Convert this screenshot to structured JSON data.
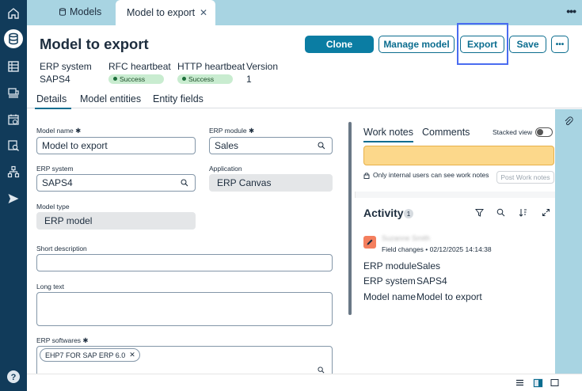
{
  "colors": {
    "primary": "#0b7da3",
    "rail": "#113b5a",
    "tabbar": "#a8d4e2",
    "success": "#c9ecd0",
    "note_bg": "#fcd88b",
    "highlight": "#4a6cf0"
  },
  "rail": {
    "icons": [
      "home-icon",
      "database-icon",
      "table-icon",
      "transport-icon",
      "schedule-icon",
      "search-doc-icon",
      "hierarchy-icon",
      "send-icon",
      "help-icon"
    ]
  },
  "tabs": {
    "models_label": "Models",
    "active_label": "Model to export"
  },
  "header": {
    "title": "Model to export",
    "buttons": {
      "clone": "Clone",
      "manage": "Manage model",
      "export": "Export",
      "save": "Save"
    }
  },
  "meta": {
    "erp_system_label": "ERP system",
    "erp_system_value": "SAPS4",
    "rfc_label": "RFC heartbeat",
    "rfc_status": "Success",
    "http_label": "HTTP heartbeat",
    "http_status": "Success",
    "version_label": "Version",
    "version_value": "1"
  },
  "subtabs": [
    "Details",
    "Model entities",
    "Entity fields"
  ],
  "form": {
    "model_name_label": "Model name",
    "model_name_value": "Model to export",
    "erp_module_label": "ERP module",
    "erp_module_value": "Sales",
    "erp_system_label": "ERP system",
    "erp_system_value": "SAPS4",
    "application_label": "Application",
    "application_value": "ERP Canvas",
    "model_type_label": "Model type",
    "model_type_value": "ERP model",
    "short_desc_label": "Short description",
    "long_text_label": "Long text",
    "erp_softwares_label": "ERP softwares",
    "erp_softwares_chip": "EHP7 FOR SAP ERP 6.0"
  },
  "notes": {
    "tab_work_notes": "Work notes",
    "tab_comments": "Comments",
    "stacked_view": "Stacked view",
    "internal_hint": "Only internal users can see work notes",
    "post_button": "Post Work notes"
  },
  "activity": {
    "title": "Activity",
    "count": "1",
    "user_name": "Suzanne Smith",
    "change_line": "Field changes • 02/12/2025 14:14:38",
    "fields": [
      {
        "key": "ERP module",
        "value": "Sales"
      },
      {
        "key": "ERP system",
        "value": "SAPS4"
      },
      {
        "key": "Model name",
        "value": "Model to export"
      }
    ]
  }
}
